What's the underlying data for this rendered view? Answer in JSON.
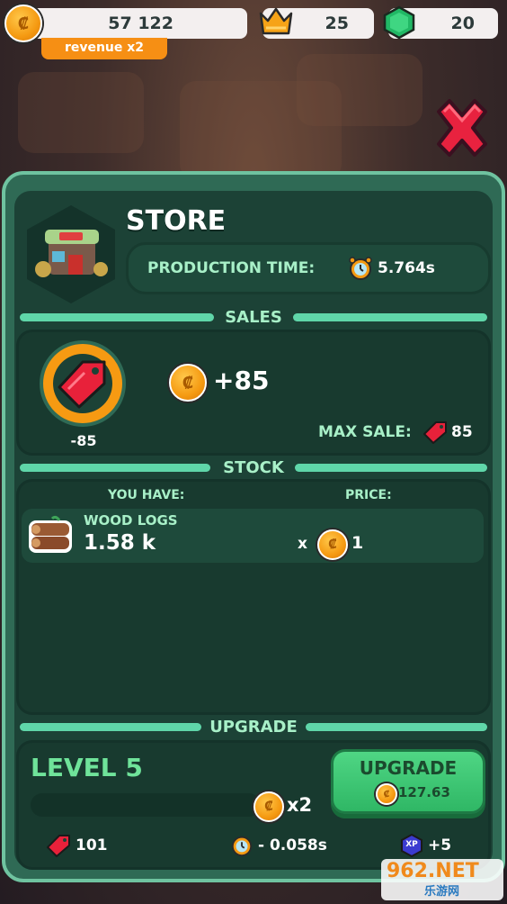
{
  "topbar": {
    "coins": "57 122",
    "revenue_badge": "revenue x2",
    "crowns": "25",
    "gems": "20"
  },
  "store": {
    "title": "STORE",
    "production_label": "PRODUCTION TIME:",
    "production_value": "5.764s"
  },
  "sales": {
    "header": "SALES",
    "timer_value": "-85",
    "income": "+85",
    "max_sale_label": "MAX SALE:",
    "max_sale_value": "85"
  },
  "stock": {
    "header": "STOCK",
    "you_have_label": "YOU HAVE:",
    "price_label": "PRICE:",
    "item_name": "WOOD LOGS",
    "item_amount": "1.58 k",
    "price_prefix": "x",
    "price_value": "1"
  },
  "upgrade": {
    "header": "UPGRADE",
    "level": "LEVEL 5",
    "multiplier": "x2",
    "button_label": "UPGRADE",
    "button_cost": "127.63",
    "tag_bonus": "101",
    "time_bonus": "- 0.058s",
    "xp_label": "XP",
    "xp_bonus": "+5"
  },
  "watermark": {
    "brand": "962.NET",
    "subtitle": "乐游网"
  },
  "colors": {
    "accent_green": "#5fd6a9",
    "panel_bg": "#2f6a55",
    "orange": "#f68f14",
    "tag_red": "#e8213a"
  }
}
